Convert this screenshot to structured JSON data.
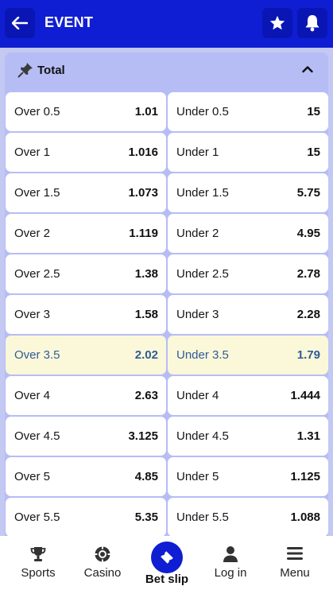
{
  "header": {
    "title": "EVENT",
    "back_icon": "arrow-left-icon",
    "favorite_icon": "star-icon",
    "notifications_icon": "bell-icon"
  },
  "market": {
    "title": "Total",
    "pin_icon": "pin-icon",
    "collapse_icon": "chevron-up-icon",
    "rows": [
      {
        "over_label": "Over 0.5",
        "over_odd": "1.01",
        "under_label": "Under 0.5",
        "under_odd": "15"
      },
      {
        "over_label": "Over 1",
        "over_odd": "1.016",
        "under_label": "Under 1",
        "under_odd": "15"
      },
      {
        "over_label": "Over 1.5",
        "over_odd": "1.073",
        "under_label": "Under 1.5",
        "under_odd": "5.75"
      },
      {
        "over_label": "Over 2",
        "over_odd": "1.119",
        "under_label": "Under 2",
        "under_odd": "4.95"
      },
      {
        "over_label": "Over 2.5",
        "over_odd": "1.38",
        "under_label": "Under 2.5",
        "under_odd": "2.78"
      },
      {
        "over_label": "Over 3",
        "over_odd": "1.58",
        "under_label": "Under 3",
        "under_odd": "2.28"
      },
      {
        "over_label": "Over 3.5",
        "over_odd": "2.02",
        "under_label": "Under 3.5",
        "under_odd": "1.79"
      },
      {
        "over_label": "Over 4",
        "over_odd": "2.63",
        "under_label": "Under 4",
        "under_odd": "1.444"
      },
      {
        "over_label": "Over 4.5",
        "over_odd": "3.125",
        "under_label": "Under 4.5",
        "under_odd": "1.31"
      },
      {
        "over_label": "Over 5",
        "over_odd": "4.85",
        "under_label": "Under 5",
        "under_odd": "1.125"
      },
      {
        "over_label": "Over 5.5",
        "over_odd": "5.35",
        "under_label": "Under 5.5",
        "under_odd": "1.088"
      }
    ]
  },
  "bottom_nav": {
    "sports": {
      "label": "Sports",
      "icon": "trophy-icon"
    },
    "casino": {
      "label": "Casino",
      "icon": "casino-chip-icon"
    },
    "bet_slip": {
      "label": "Bet slip",
      "icon": "ticket-icon"
    },
    "login": {
      "label": "Log in",
      "icon": "user-icon"
    },
    "menu": {
      "label": "Menu",
      "icon": "hamburger-menu-icon"
    }
  },
  "colors": {
    "brand": "#0f1ed2",
    "market_background": "#b6bdf5",
    "highlight_row": "#fbf8d9",
    "highlight_text": "#2f5c99"
  }
}
